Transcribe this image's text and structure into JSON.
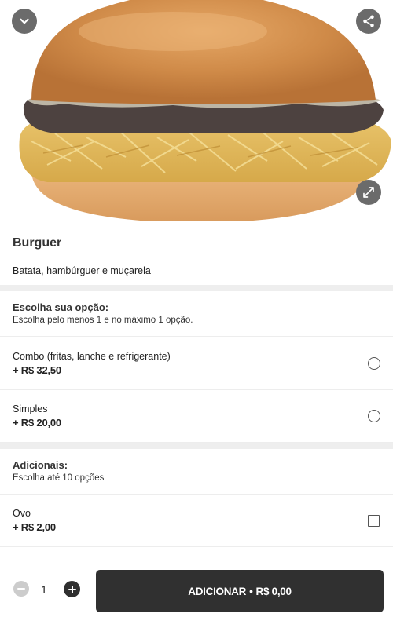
{
  "hero": {
    "image_alt": "Burguer",
    "collapse_icon": "chevron-down-icon",
    "share_icon": "share-icon",
    "expand_icon": "expand-icon"
  },
  "product": {
    "title": "Burguer",
    "description": "Batata, hambúrguer e muçarela"
  },
  "groups": [
    {
      "title": "Escolha sua opção:",
      "subtitle": "Escolha pelo menos 1 e no máximo 1 opção.",
      "control": "radio",
      "options": [
        {
          "name": "Combo (fritas, lanche e refrigerante)",
          "price": "+ R$ 32,50",
          "selected": false
        },
        {
          "name": "Simples",
          "price": "+ R$ 20,00",
          "selected": false
        }
      ]
    },
    {
      "title": "Adicionais:",
      "subtitle": "Escolha até 10 opções",
      "control": "checkbox",
      "options": [
        {
          "name": "Ovo",
          "price": "+ R$ 2,00",
          "selected": false
        }
      ]
    }
  ],
  "footer": {
    "quantity": "1",
    "add_label": "ADICIONAR",
    "separator": "•",
    "add_total": "R$ 0,00",
    "minus_icon": "minus-icon",
    "plus_icon": "plus-icon"
  },
  "colors": {
    "dark": "#303030",
    "icon_button": "#6b6b6b",
    "divider": "#eeeeee"
  }
}
